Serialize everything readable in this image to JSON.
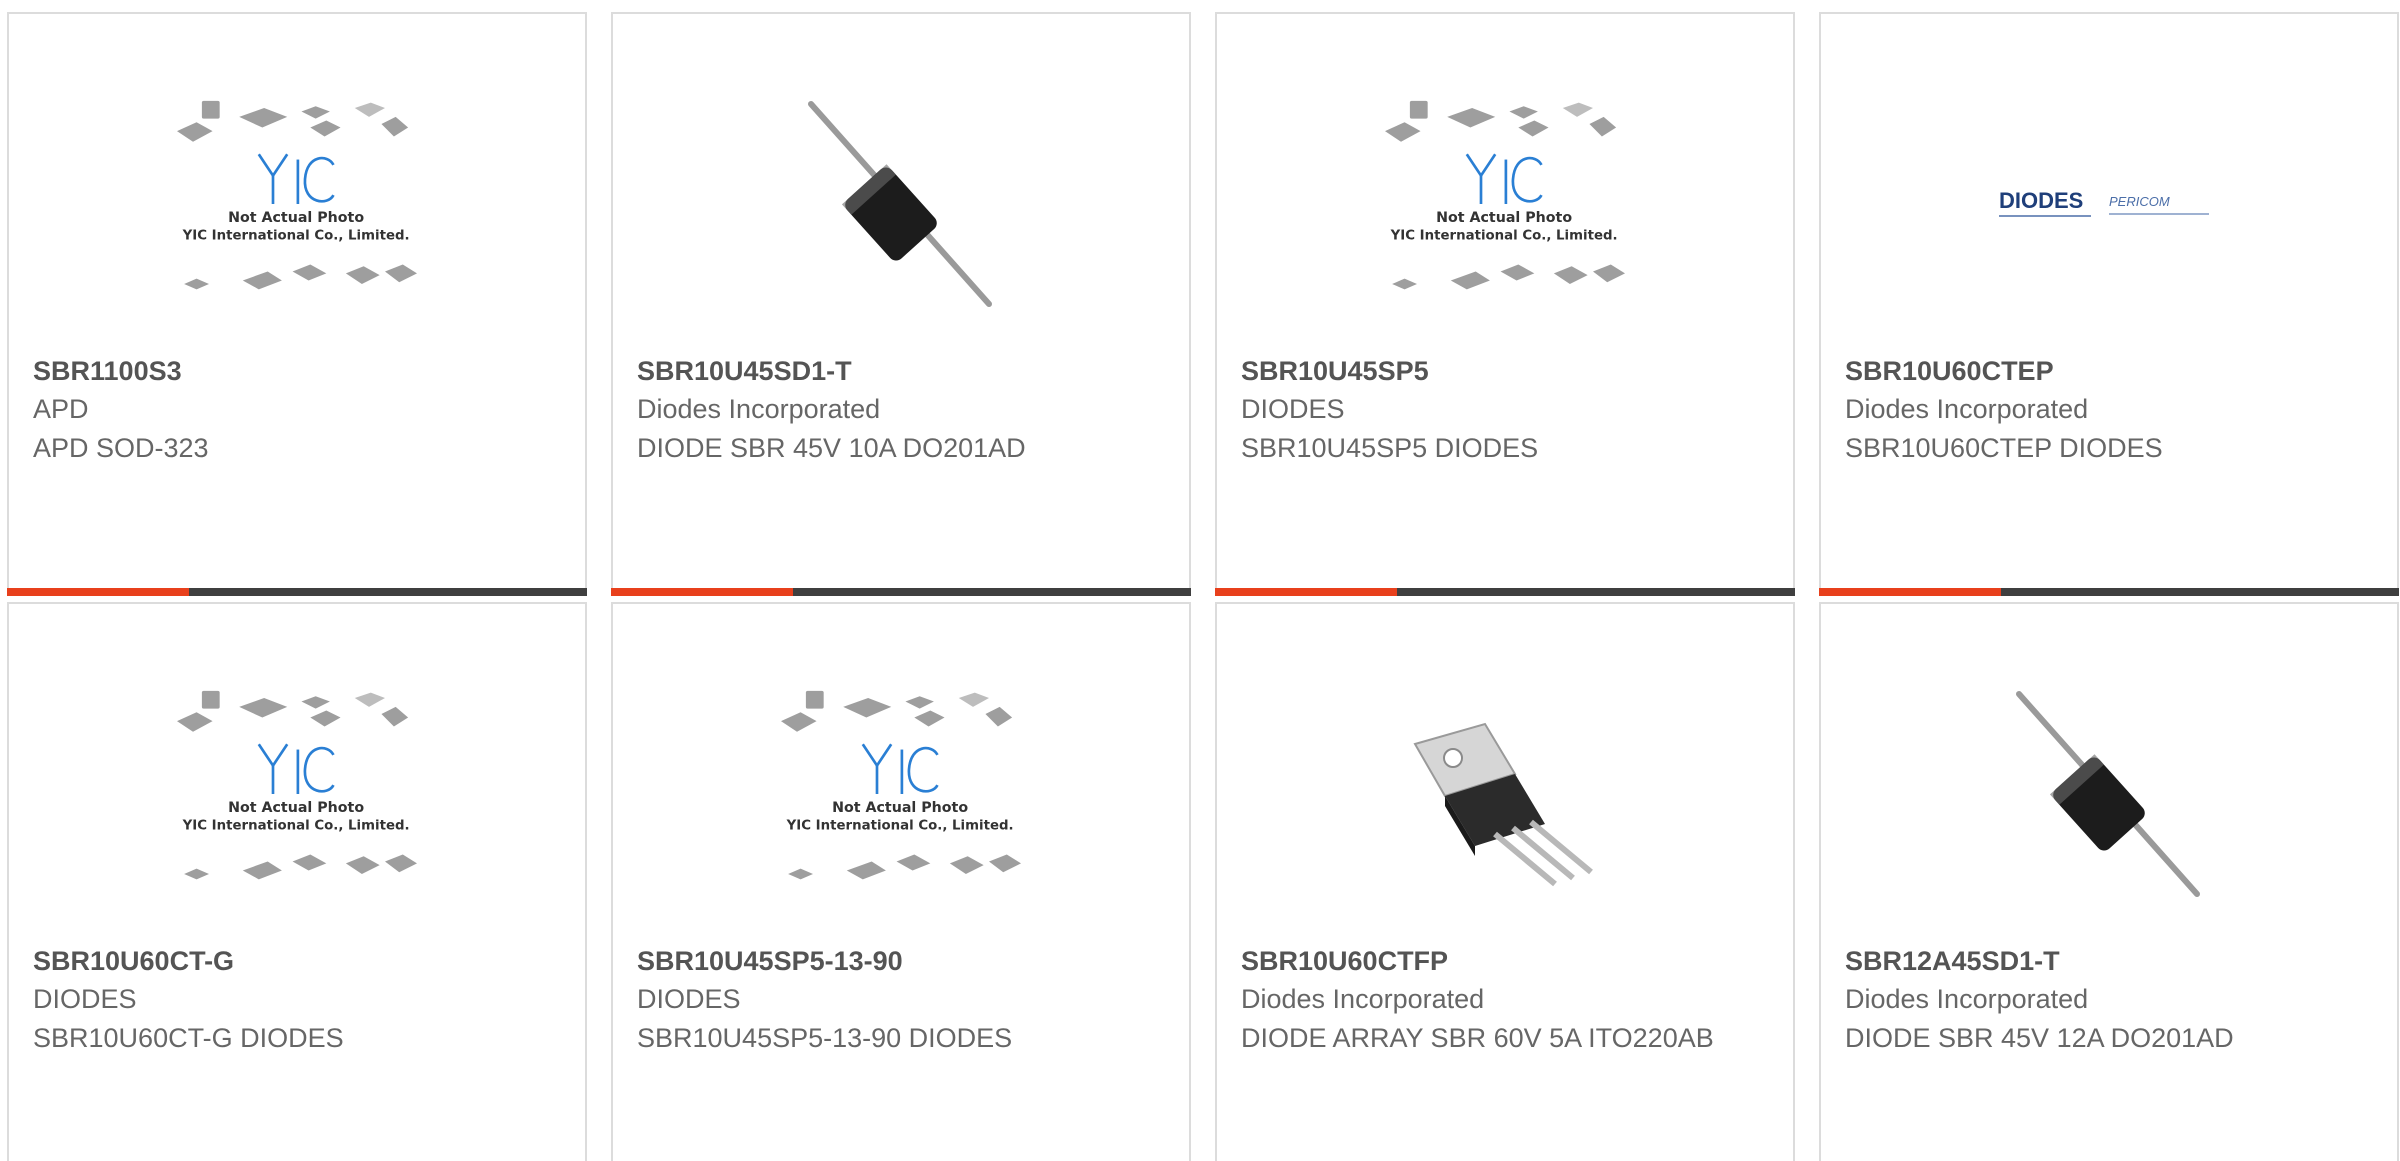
{
  "accent_color": "#e8401c",
  "bar_color": "#3f3f3f",
  "products": [
    {
      "part_number": "SBR1100S3",
      "manufacturer": "APD",
      "description": "APD SOD-323",
      "image": "yic-placeholder",
      "placeholder_line1": "Not Actual Photo",
      "placeholder_line2": "YIC International Co., Limited."
    },
    {
      "part_number": "SBR10U45SD1-T",
      "manufacturer": "Diodes Incorporated",
      "description": "DIODE SBR 45V 10A DO201AD",
      "image": "axial-diode"
    },
    {
      "part_number": "SBR10U45SP5",
      "manufacturer": "DIODES",
      "description": "SBR10U45SP5 DIODES",
      "image": "yic-placeholder",
      "placeholder_line1": "Not Actual Photo",
      "placeholder_line2": "YIC International Co., Limited."
    },
    {
      "part_number": "SBR10U60CTEP",
      "manufacturer": "Diodes Incorporated",
      "description": "SBR10U60CTEP DIODES",
      "image": "diodes-pericom-logo",
      "logo_text_1": "DIODES",
      "logo_text_2": "PERICOM"
    },
    {
      "part_number": "SBR10U60CT-G",
      "manufacturer": "DIODES",
      "description": "SBR10U60CT-G DIODES",
      "image": "yic-placeholder",
      "placeholder_line1": "Not Actual Photo",
      "placeholder_line2": "YIC International Co., Limited."
    },
    {
      "part_number": "SBR10U45SP5-13-90",
      "manufacturer": "DIODES",
      "description": "SBR10U45SP5-13-90 DIODES",
      "image": "yic-placeholder",
      "placeholder_line1": "Not Actual Photo",
      "placeholder_line2": "YIC International Co., Limited."
    },
    {
      "part_number": "SBR10U60CTFP",
      "manufacturer": "Diodes Incorporated",
      "description": "DIODE ARRAY SBR 60V 5A ITO220AB",
      "image": "to220-package"
    },
    {
      "part_number": "SBR12A45SD1-T",
      "manufacturer": "Diodes Incorporated",
      "description": "DIODE SBR 45V 12A DO201AD",
      "image": "axial-diode"
    }
  ]
}
